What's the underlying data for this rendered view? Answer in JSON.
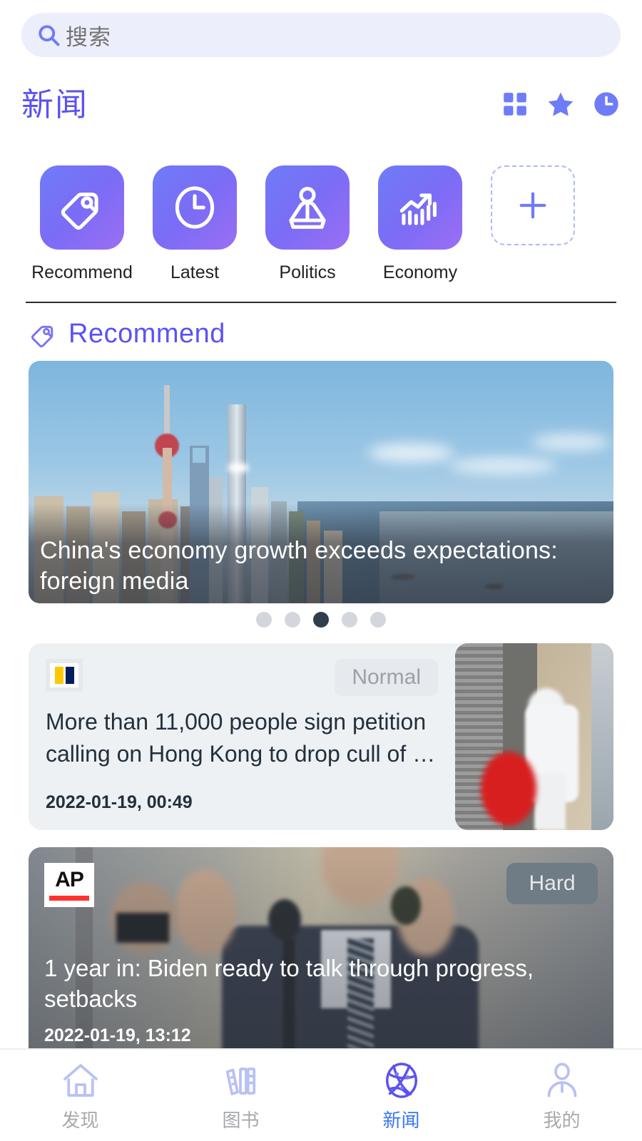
{
  "search": {
    "placeholder": "搜索",
    "icon": "search-icon"
  },
  "header": {
    "title": "新闻",
    "actions": [
      {
        "name": "grid-icon",
        "label": "grid"
      },
      {
        "name": "star-icon",
        "label": "star"
      },
      {
        "name": "clock-icon",
        "label": "clock"
      }
    ]
  },
  "categories": {
    "items": [
      {
        "label": "Recommend",
        "icon": "tag-search-icon"
      },
      {
        "label": "Latest",
        "icon": "clock-icon"
      },
      {
        "label": "Politics",
        "icon": "podium-speaker-icon"
      },
      {
        "label": "Economy",
        "icon": "chart-growth-icon"
      }
    ],
    "add_label": "+",
    "add_icon": "plus-icon"
  },
  "section": {
    "title": "Recommend",
    "icon": "tag-search-icon"
  },
  "carousel": {
    "title": "China's economy growth exceeds expectations: foreign media",
    "dots_total": 5,
    "dots_active_index": 2,
    "image_alt": "Shanghai Pudong skyline with Oriental Pearl Tower over Huangpu River"
  },
  "articles": [
    {
      "layout": "list",
      "source_logo": "reuters-logo",
      "badge": "Normal",
      "title": "More than 11,000 people sign petition calling on Hong Kong to drop cull of …",
      "time": "2022-01-19, 00:49",
      "image_alt": "Worker in white protective suit carrying a red bag near a metal shutter"
    },
    {
      "layout": "hero",
      "source_logo": "ap-logo",
      "source_logo_text": "AP",
      "badge": "Hard",
      "title": "1 year in: Biden ready to talk through progress, setbacks",
      "time": "2022-01-19, 13:12",
      "image_alt": "Man in dark suit speaking at microphones with hands raised"
    }
  ],
  "tabbar": {
    "items": [
      {
        "label": "发现",
        "icon": "home-icon",
        "active": false
      },
      {
        "label": "图书",
        "icon": "books-icon",
        "active": false
      },
      {
        "label": "新闻",
        "icon": "globe-news-icon",
        "active": true
      },
      {
        "label": "我的",
        "icon": "person-icon",
        "active": false
      }
    ]
  },
  "colors": {
    "accent": "#5b52f2",
    "accent_soft": "#aeb8fb",
    "tab_active": "#3b74f5",
    "search_bg": "#eceefb",
    "card_bg": "#eef1f4"
  }
}
